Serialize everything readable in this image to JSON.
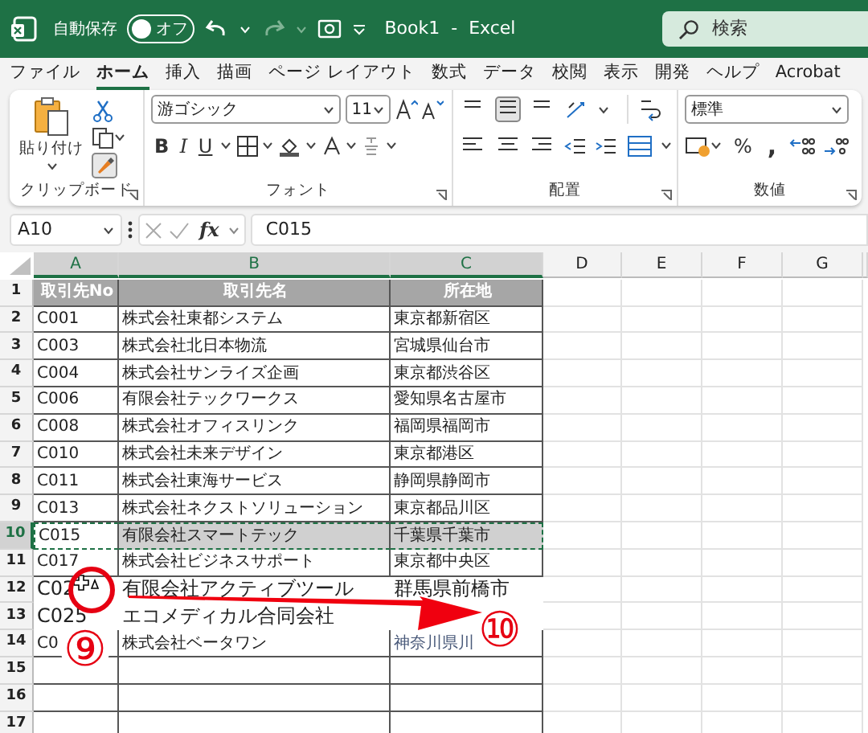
{
  "title_bar": {
    "autosave_label": "自動保存",
    "autosave": {
      "label": "オフ",
      "on": false
    },
    "title": "Book1  -  Excel",
    "search": {
      "placeholder": "検索"
    }
  },
  "menu_tabs": [
    {
      "label": "ファイル",
      "selected": false
    },
    {
      "label": "ホーム",
      "selected": true
    },
    {
      "label": "挿入",
      "selected": false
    },
    {
      "label": "描画",
      "selected": false
    },
    {
      "label": "ページ レイアウト",
      "selected": false
    },
    {
      "label": "数式",
      "selected": false
    },
    {
      "label": "データ",
      "selected": false
    },
    {
      "label": "校閲",
      "selected": false
    },
    {
      "label": "表示",
      "selected": false
    },
    {
      "label": "開発",
      "selected": false
    },
    {
      "label": "ヘルプ",
      "selected": false
    },
    {
      "label": "Acrobat",
      "selected": false
    }
  ],
  "ribbon": {
    "clipboard": {
      "name": "クリップボード",
      "paste_label": "貼り付け"
    },
    "font": {
      "name": "フォント",
      "font_name": "游ゴシック",
      "font_size": "11",
      "bold": "B",
      "italic": "I",
      "underline": "U"
    },
    "alignment": {
      "name": "配置"
    },
    "number": {
      "name": "数値",
      "format": "標準",
      "percent": "%",
      "comma": ","
    }
  },
  "formula_bar": {
    "name_box": "A10",
    "fx": "fx",
    "formula": "C015"
  },
  "sheet": {
    "columns": [
      {
        "label": "A",
        "selected": true
      },
      {
        "label": "B",
        "selected": true
      },
      {
        "label": "C",
        "selected": true
      },
      {
        "label": "D",
        "selected": false
      },
      {
        "label": "E",
        "selected": false
      },
      {
        "label": "F",
        "selected": false
      },
      {
        "label": "G",
        "selected": false
      }
    ],
    "rows": [
      {
        "number": "1",
        "kind": "header",
        "selected": false,
        "cells": [
          "取引先No",
          "取引先名",
          "所在地"
        ]
      },
      {
        "number": "2",
        "kind": "data",
        "selected": false,
        "cells": [
          "C001",
          "株式会社東都システム",
          "東京都新宿区"
        ]
      },
      {
        "number": "3",
        "kind": "data",
        "selected": false,
        "cells": [
          "C003",
          "株式会社北日本物流",
          "宮城県仙台市"
        ]
      },
      {
        "number": "4",
        "kind": "data",
        "selected": false,
        "cells": [
          "C004",
          "株式会社サンライズ企画",
          "東京都渋谷区"
        ]
      },
      {
        "number": "5",
        "kind": "data",
        "selected": false,
        "cells": [
          "C006",
          "有限会社テックワークス",
          "愛知県名古屋市"
        ]
      },
      {
        "number": "6",
        "kind": "data",
        "selected": false,
        "cells": [
          "C008",
          "株式会社オフィスリンク",
          "福岡県福岡市"
        ]
      },
      {
        "number": "7",
        "kind": "data",
        "selected": false,
        "cells": [
          "C010",
          "株式会社未来デザイン",
          "東京都港区"
        ]
      },
      {
        "number": "8",
        "kind": "data",
        "selected": false,
        "cells": [
          "C011",
          "株式会社東海サービス",
          "静岡県静岡市"
        ]
      },
      {
        "number": "9",
        "kind": "data",
        "selected": false,
        "cells": [
          "C013",
          "株式会社ネクストソリューション",
          "東京都品川区"
        ]
      },
      {
        "number": "10",
        "kind": "data",
        "selected": true,
        "cells": [
          "C015",
          "有限会社スマートテック",
          "千葉県千葉市"
        ]
      },
      {
        "number": "11",
        "kind": "data",
        "selected": false,
        "cells": [
          "C017",
          "株式会社ビジネスサポート",
          "東京都中央区"
        ]
      },
      {
        "number": "12",
        "kind": "floating",
        "selected": false,
        "cells": [
          "C02",
          "有限会社アクティブツール",
          "群馬県前橋市"
        ]
      },
      {
        "number": "13",
        "kind": "floating",
        "selected": false,
        "cells": [
          "C025",
          "エコメディカル合同会社"
        ]
      },
      {
        "number": "14",
        "kind": "data",
        "selected": false,
        "cells": [
          "C0",
          "株式会社ベータワン",
          "神奈川県川"
        ]
      },
      {
        "number": "15",
        "kind": "empty",
        "selected": false
      },
      {
        "number": "16",
        "kind": "empty",
        "selected": false
      },
      {
        "number": "17",
        "kind": "empty",
        "selected": false
      }
    ]
  },
  "annotations": {
    "markers": [
      {
        "label": "⑨"
      },
      {
        "label": "⑩"
      }
    ]
  }
}
